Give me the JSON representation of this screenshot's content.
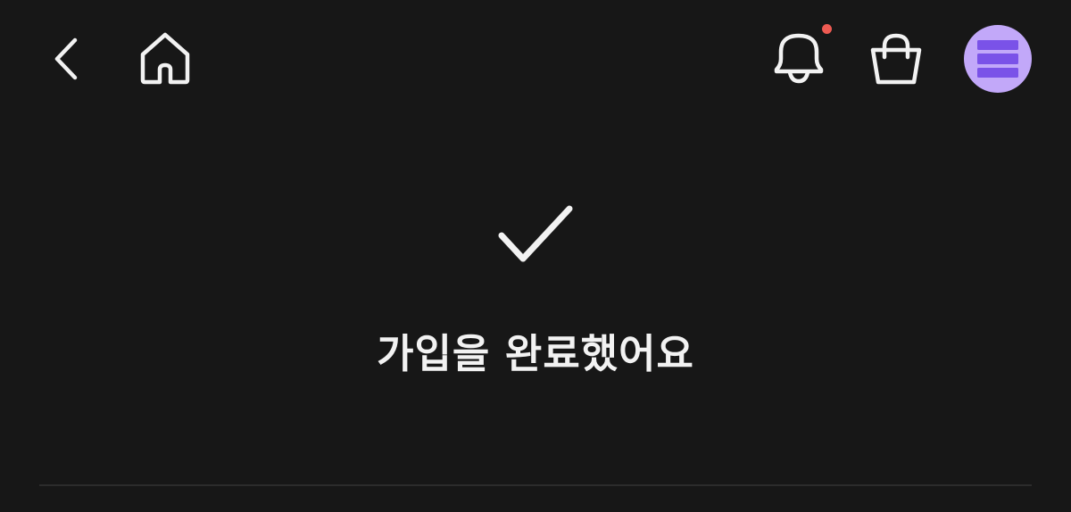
{
  "header": {
    "back_icon": "chevron-left-icon",
    "home_icon": "home-icon",
    "notification_icon": "bell-icon",
    "cart_icon": "shopping-bag-icon",
    "profile_icon": "menu-stack-icon",
    "notification_dot_color": "#ee5a52",
    "avatar_color": "#c2a8f9",
    "avatar_stripe_color": "#7a52e8"
  },
  "main": {
    "status_icon": "checkmark-icon",
    "title": "가입을 완료했어요"
  },
  "colors": {
    "background": "#171717",
    "foreground": "#f2f2f2",
    "divider": "#2c2c2c"
  }
}
